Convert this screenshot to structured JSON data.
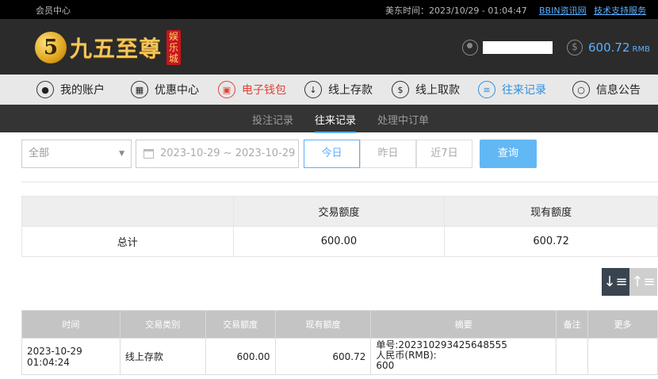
{
  "topbar": {
    "member_center": "会员中心",
    "time_label": "美东时间：2023/10/29 - 01:04:47",
    "news_link": "BBIN资讯网",
    "support_link": "技术支持服务"
  },
  "header": {
    "logo_mark": "5",
    "logo_text": "九五至尊",
    "logo_badge": "娱乐城",
    "balance": "600.72",
    "balance_unit": "RMB"
  },
  "nav": {
    "items": [
      {
        "label": "我的账户",
        "icon": "user-icon"
      },
      {
        "label": "优惠中心",
        "icon": "gift-icon"
      },
      {
        "label": "电子钱包",
        "icon": "wallet-icon"
      },
      {
        "label": "线上存款",
        "icon": "deposit-icon"
      },
      {
        "label": "线上取款",
        "icon": "withdraw-icon"
      },
      {
        "label": "往来记录",
        "icon": "history-icon"
      },
      {
        "label": "信息公告",
        "icon": "bell-icon"
      }
    ]
  },
  "subnav": {
    "items": [
      "投注记录",
      "往来记录",
      "处理中订单"
    ]
  },
  "filter": {
    "type_value": "全部",
    "date_range": "2023-10-29 ~ 2023-10-29",
    "quick": [
      "今日",
      "昨日",
      "近7日"
    ],
    "query_label": "查询"
  },
  "summary": {
    "headers": [
      "",
      "交易额度",
      "现有额度"
    ],
    "row": [
      "总计",
      "600.00",
      "600.72"
    ]
  },
  "records": {
    "headers": [
      "时间",
      "交易类别",
      "交易额度",
      "现有额度",
      "摘要",
      "备注",
      "更多"
    ],
    "rows": [
      {
        "time": "2023-10-29 01:04:24",
        "type": "线上存款",
        "amount": "600.00",
        "balance": "600.72",
        "memo_line1": "单号:202310293425648555",
        "memo_line2": "人民币(RMB):",
        "memo_line3": "600",
        "note": "",
        "more": ""
      }
    ]
  },
  "colors": {
    "accent_blue": "#5cb0ff",
    "accent_red": "#e0433a",
    "header_bg": "#2b2b2b"
  }
}
